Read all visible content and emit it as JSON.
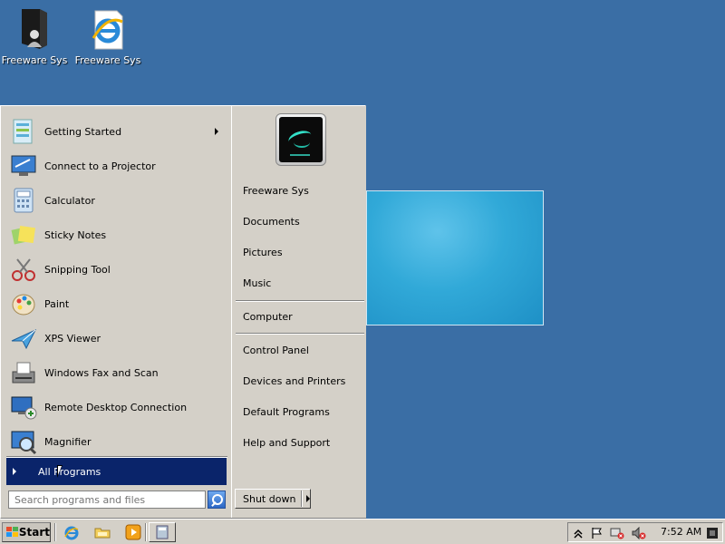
{
  "desktop": {
    "icons": [
      {
        "label": "Freeware Sys",
        "icon": "user-folder-icon"
      },
      {
        "label": "Freeware Sys",
        "icon": "internet-explorer-icon"
      }
    ]
  },
  "start_menu": {
    "programs": [
      {
        "label": "Getting Started",
        "icon": "getting-started-icon",
        "has_submenu": true
      },
      {
        "label": "Connect to a Projector",
        "icon": "projector-icon"
      },
      {
        "label": "Calculator",
        "icon": "calculator-icon"
      },
      {
        "label": "Sticky Notes",
        "icon": "sticky-notes-icon"
      },
      {
        "label": "Snipping Tool",
        "icon": "scissors-icon"
      },
      {
        "label": "Paint",
        "icon": "paint-palette-icon"
      },
      {
        "label": "XPS Viewer",
        "icon": "xps-viewer-icon"
      },
      {
        "label": "Windows Fax and Scan",
        "icon": "fax-icon"
      },
      {
        "label": "Remote Desktop Connection",
        "icon": "remote-desktop-icon"
      },
      {
        "label": "Magnifier",
        "icon": "magnifier-icon"
      }
    ],
    "all_programs": "All Programs",
    "search_placeholder": "Search programs and files",
    "right_links": [
      "Freeware Sys",
      "Documents",
      "Pictures",
      "Music",
      "Computer",
      "Control Panel",
      "Devices and Printers",
      "Default Programs",
      "Help and Support"
    ],
    "shutdown_label": "Shut down"
  },
  "taskbar": {
    "start_label": "Start",
    "quick_launch": [
      "internet-explorer-icon",
      "explorer-folder-icon",
      "media-player-icon"
    ],
    "clock": "7:52 AM",
    "accent_color": "#0a246a",
    "desktop_color": "#3a6ea5"
  }
}
